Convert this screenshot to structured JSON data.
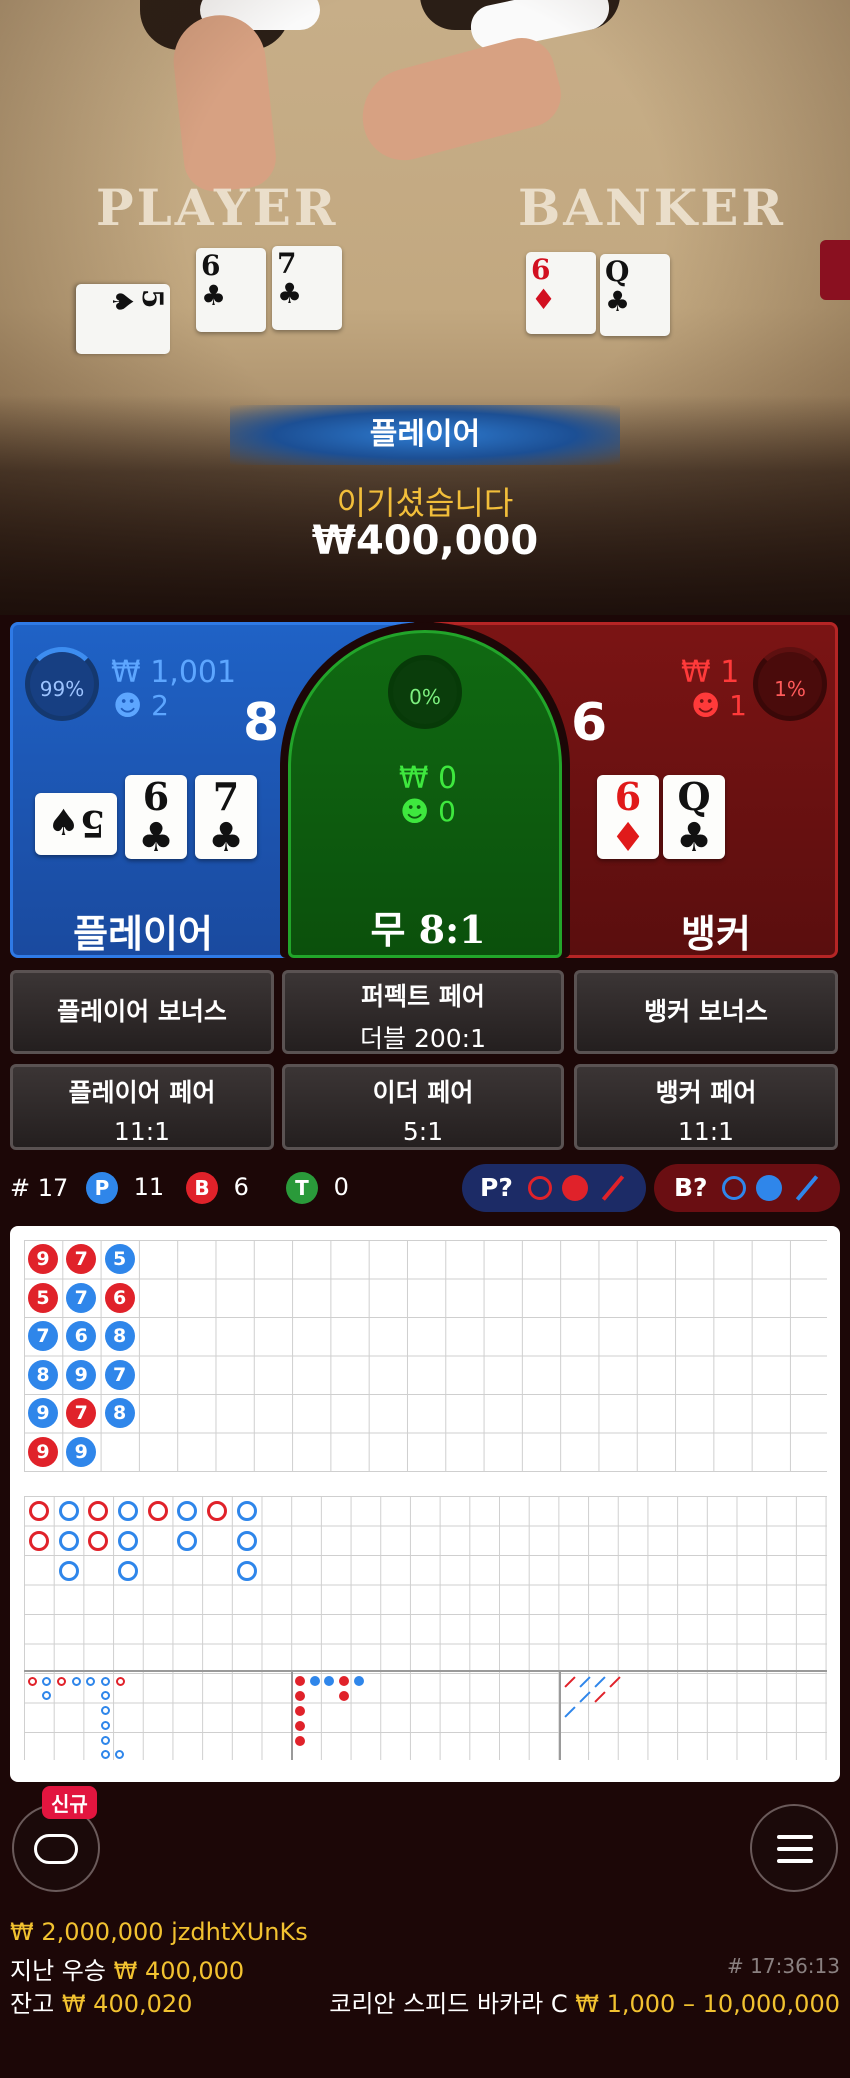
{
  "table": {
    "player_word": "PLAYER",
    "banker_word": "BANKER",
    "player_cards": [
      {
        "rank": "5",
        "suit": "♠",
        "color": "black"
      },
      {
        "rank": "6",
        "suit": "♣",
        "color": "black"
      },
      {
        "rank": "7",
        "suit": "♣",
        "color": "black"
      }
    ],
    "banker_cards": [
      {
        "rank": "6",
        "suit": "♦",
        "color": "red"
      },
      {
        "rank": "Q",
        "suit": "♣",
        "color": "black"
      }
    ]
  },
  "result": {
    "winner": "플레이어",
    "message": "이기셨습니다",
    "amount": "₩400,000"
  },
  "player_spot": {
    "percent": "99%",
    "amount": "₩ 1,001",
    "players": "2",
    "score": "8",
    "label": "플레이어",
    "cards": [
      {
        "rank": "5",
        "suit": "♠",
        "color": "black"
      },
      {
        "rank": "6",
        "suit": "♣",
        "color": "black"
      },
      {
        "rank": "7",
        "suit": "♣",
        "color": "black"
      }
    ]
  },
  "tie_spot": {
    "percent": "0%",
    "amount": "₩ 0",
    "players": "0",
    "label": "무",
    "odds": "8:1"
  },
  "banker_spot": {
    "percent": "1%",
    "amount": "₩ 1",
    "players": "1",
    "score": "6",
    "label": "뱅커",
    "cards": [
      {
        "rank": "6",
        "suit": "♦",
        "color": "red"
      },
      {
        "rank": "Q",
        "suit": "♣",
        "color": "black"
      }
    ]
  },
  "side_bets": {
    "player_bonus": "플레이어 보너스",
    "perfect_pair_line1": "퍼펙트 페어",
    "perfect_pair_line2": "더블 200:1",
    "banker_bonus": "뱅커 보너스",
    "player_pair": "플레이어 페어",
    "player_pair_odds": "11:1",
    "either_pair": "이더 페어",
    "either_pair_odds": "5:1",
    "banker_pair": "뱅커 페어",
    "banker_pair_odds": "11:1"
  },
  "stats": {
    "round_label": "# 17",
    "p_letter": "P",
    "p_count": "11",
    "b_letter": "B",
    "b_count": "6",
    "t_letter": "T",
    "t_count": "0",
    "p_predict": "P?",
    "b_predict": "B?"
  },
  "bead_road": [
    [
      "9",
      "red"
    ],
    [
      "5",
      "red"
    ],
    [
      "7",
      "blue"
    ],
    [
      "8",
      "blue"
    ],
    [
      "9",
      "blue"
    ],
    [
      "9",
      "red"
    ],
    [
      "7",
      "red"
    ],
    [
      "7",
      "blue"
    ],
    [
      "6",
      "blue"
    ],
    [
      "9",
      "blue"
    ],
    [
      "7",
      "red"
    ],
    [
      "9",
      "blue"
    ],
    [
      "5",
      "blue"
    ],
    [
      "6",
      "red"
    ],
    [
      "8",
      "blue"
    ],
    [
      "7",
      "blue"
    ],
    [
      "8",
      "blue"
    ]
  ],
  "colors": {
    "player_blue": "#2f86ea",
    "banker_red": "#e0222a",
    "tie_green": "#2a9a3a",
    "gold": "#f2c230"
  },
  "menu": {
    "new_badge": "신규"
  },
  "footer": {
    "account": "₩ 2,000,000 jzdhtXUnKs",
    "last_win_label": "지난 우승",
    "last_win_amount": "₩ 400,000",
    "balance_label": "잔고",
    "balance_amount": "₩ 400,020",
    "round_id": "# 17:36:13",
    "table_name": "코리안 스피드 바카라 C",
    "limits": "₩ 1,000 – 10,000,000"
  }
}
